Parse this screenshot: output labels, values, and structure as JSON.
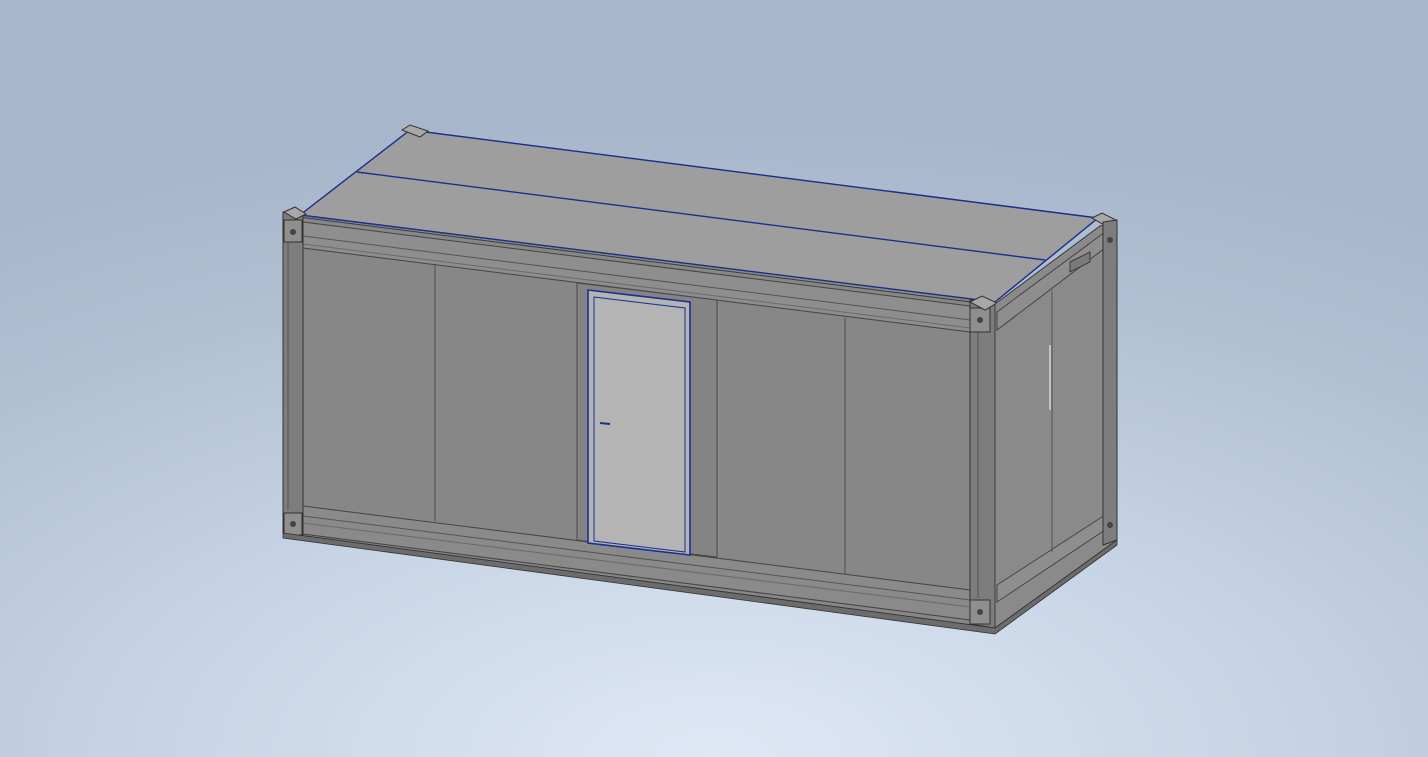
{
  "viewport": {
    "background_colors": [
      "#dfe8f5",
      "#a8b6cb"
    ],
    "selection_highlight_color": "#1a2f8f"
  },
  "model": {
    "body_color": "#8a8a8a",
    "roof_color": "#9c9c9c",
    "door_color": "#b2b2b2",
    "end_wall_color": "#878787"
  }
}
